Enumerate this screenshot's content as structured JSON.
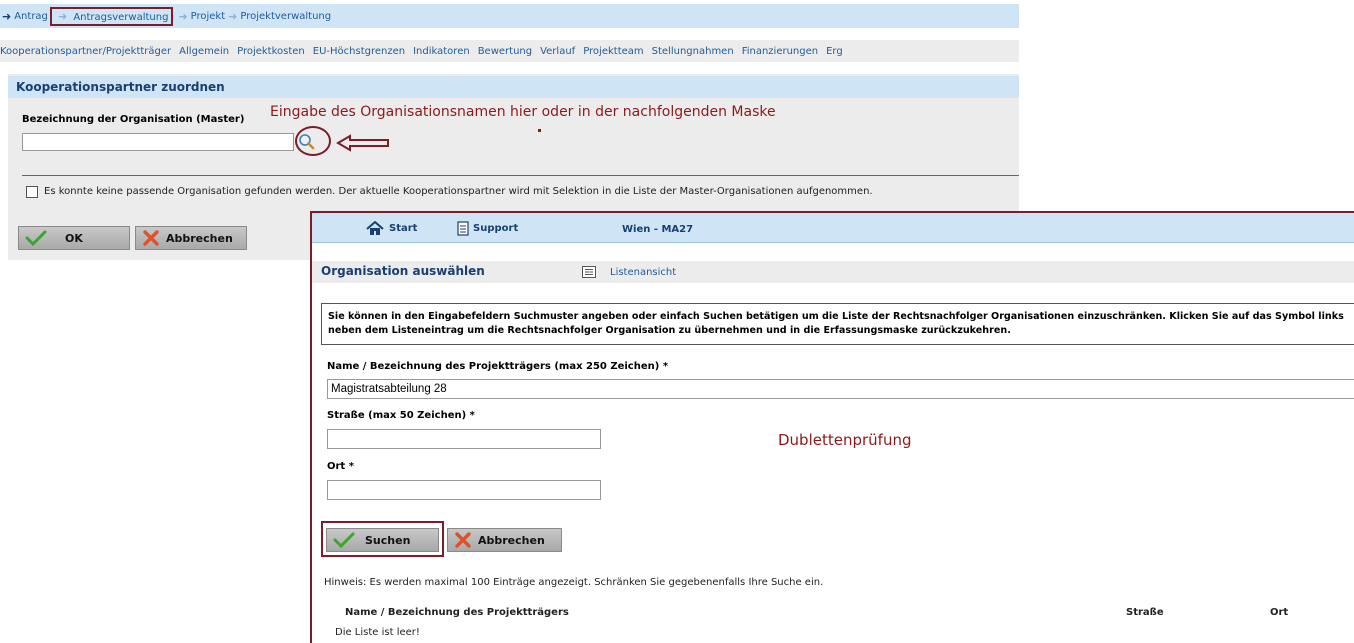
{
  "breadcrumb": {
    "items": [
      "Antrag",
      "Antragsverwaltung",
      "Projekt",
      "Projektverwaltung"
    ]
  },
  "tabs": [
    "Kooperationspartner/Projektträger",
    "Allgemein",
    "Projektkosten",
    "EU-Höchstgrenzen",
    "Indikatoren",
    "Bewertung",
    "Verlauf",
    "Projektteam",
    "Stellungnahmen",
    "Finanzierungen",
    "Erg"
  ],
  "panel": {
    "title": "Kooperationspartner zuordnen",
    "org_label": "Bezeichnung der Organisation (Master)",
    "org_value": "",
    "no_match_text": "Es konnte keine passende Organisation gefunden werden. Der aktuelle Kooperationspartner wird mit Selektion in die Liste der Master-Organisationen aufgenommen.",
    "ok_label": "OK",
    "cancel_label": "Abbrechen"
  },
  "annotations": {
    "top": "Eingabe des Organisationsnamen hier oder in der nachfolgenden Maske",
    "dialog": "Dublettenprüfung"
  },
  "dialog": {
    "start_label": "Start",
    "support_label": "Support",
    "location": "Wien - MA27",
    "title": "Organisation auswählen",
    "list_view_label": "Listenansicht",
    "info_text": "Sie können in den Eingabefeldern Suchmuster angeben oder einfach Suchen betätigen um die Liste der Rechtsnachfolger Organisationen einzuschränken. Klicken Sie auf das Symbol links neben dem Listeneintrag um die Rechtsnachfolger Organisation zu übernehmen und in die Erfassungsmaske zurückzukehren.",
    "name_label": "Name / Bezeichnung des Projektträgers (max 250 Zeichen)",
    "name_value": "Magistratsabteilung 28",
    "street_label": "Straße (max 50 Zeichen)",
    "street_value": "",
    "city_label": "Ort",
    "city_value": "",
    "required_mark": "*",
    "search_label": "Suchen",
    "cancel_label": "Abbrechen",
    "hint": "Hinweis: Es werden maximal 100 Einträge angezeigt. Schränken Sie gegebenenfalls Ihre Suche ein.",
    "columns": [
      "Name / Bezeichnung des Projektträgers",
      "Straße",
      "Ort"
    ],
    "empty_text": "Die Liste ist leer!"
  },
  "colors": {
    "header_blue": "#cfe5f5",
    "link_blue": "#1f5c9a",
    "annotation_red": "#8b1a1a",
    "highlight_border": "#7a1f2a"
  }
}
